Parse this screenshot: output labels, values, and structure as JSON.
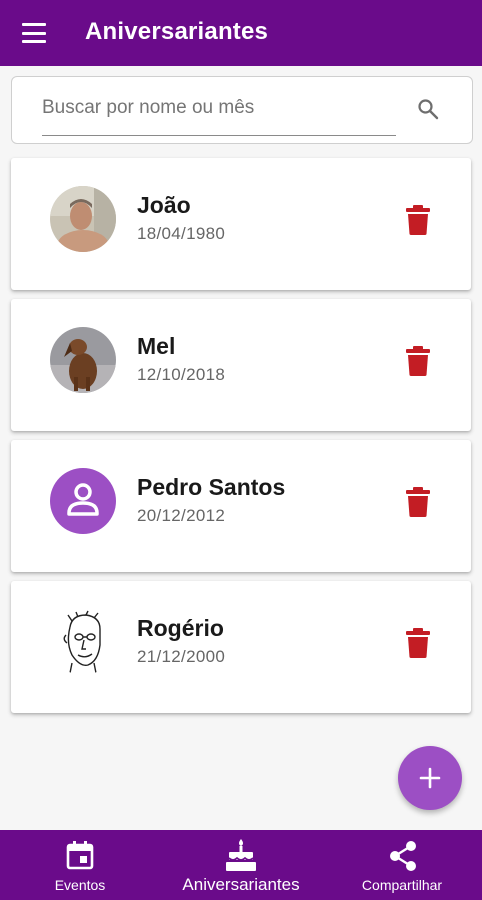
{
  "appbar": {
    "title": "Aniversariantes",
    "menu_icon": "menu-icon"
  },
  "search": {
    "placeholder": "Buscar por nome ou mês",
    "value": "",
    "icon": "search-icon"
  },
  "birthdays": [
    {
      "name": "João",
      "date": "18/04/1980",
      "avatar": "photo-man"
    },
    {
      "name": "Mel",
      "date": "12/10/2018",
      "avatar": "photo-dog"
    },
    {
      "name": "Pedro Santos",
      "date": "20/12/2012",
      "avatar": "person-icon"
    },
    {
      "name": "Rogério",
      "date": "21/12/2000",
      "avatar": "caricature"
    }
  ],
  "fab": {
    "icon": "plus-icon"
  },
  "bottom_nav": [
    {
      "label": "Eventos",
      "icon": "calendar-icon"
    },
    {
      "label": "Aniversariantes",
      "icon": "cake-icon",
      "active": true
    },
    {
      "label": "Compartilhar",
      "icon": "share-icon"
    }
  ],
  "colors": {
    "primary": "#6a0b8a",
    "accent": "#9c4fc4",
    "delete": "#c31d24"
  }
}
